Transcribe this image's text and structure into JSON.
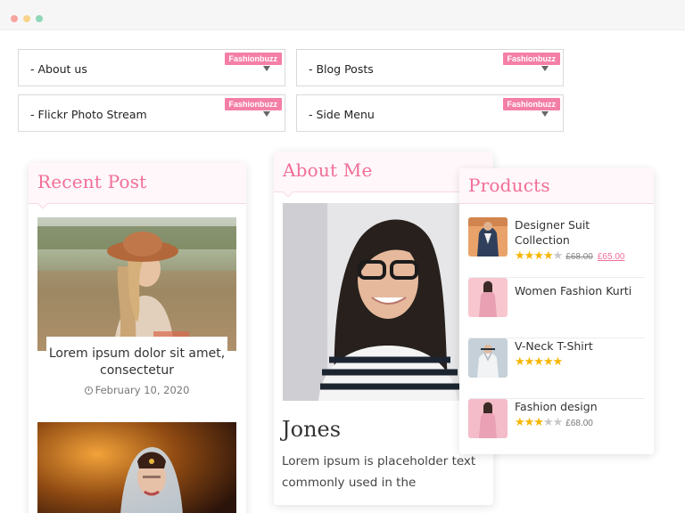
{
  "window": {
    "controls": [
      "close",
      "minimize",
      "maximize"
    ]
  },
  "widgets": [
    {
      "label": "- About us",
      "badge": "Fashionbuzz"
    },
    {
      "label": "- Blog Posts",
      "badge": "Fashionbuzz"
    },
    {
      "label": "- Flickr Photo Stream",
      "badge": "Fashionbuzz"
    },
    {
      "label": "- Side Menu",
      "badge": "Fashionbuzz"
    }
  ],
  "recent_post": {
    "title": "Recent Post",
    "posts": [
      {
        "title": "Lorem ipsum dolor sit amet, consectetur",
        "date": "February 10, 2020",
        "icon": "clock-icon"
      }
    ]
  },
  "about_me": {
    "title": "About Me",
    "name": "Jones",
    "text": "Lorem ipsum is placeholder text commonly used in the"
  },
  "products": {
    "title": "Products",
    "items": [
      {
        "name": "Designer Suit Collection",
        "rating": 4,
        "old_price": "£68.00",
        "price": "£65.00"
      },
      {
        "name": "Women Fashion Kurti",
        "rating": 0,
        "price": ""
      },
      {
        "name": "V-Neck T-Shirt",
        "rating": 5,
        "price": ""
      },
      {
        "name": "Fashion design",
        "rating": 3,
        "price": "£68.00"
      }
    ]
  },
  "colors": {
    "accent": "#f26e98",
    "badge": "#f47fa6",
    "star": "#f7b500"
  }
}
